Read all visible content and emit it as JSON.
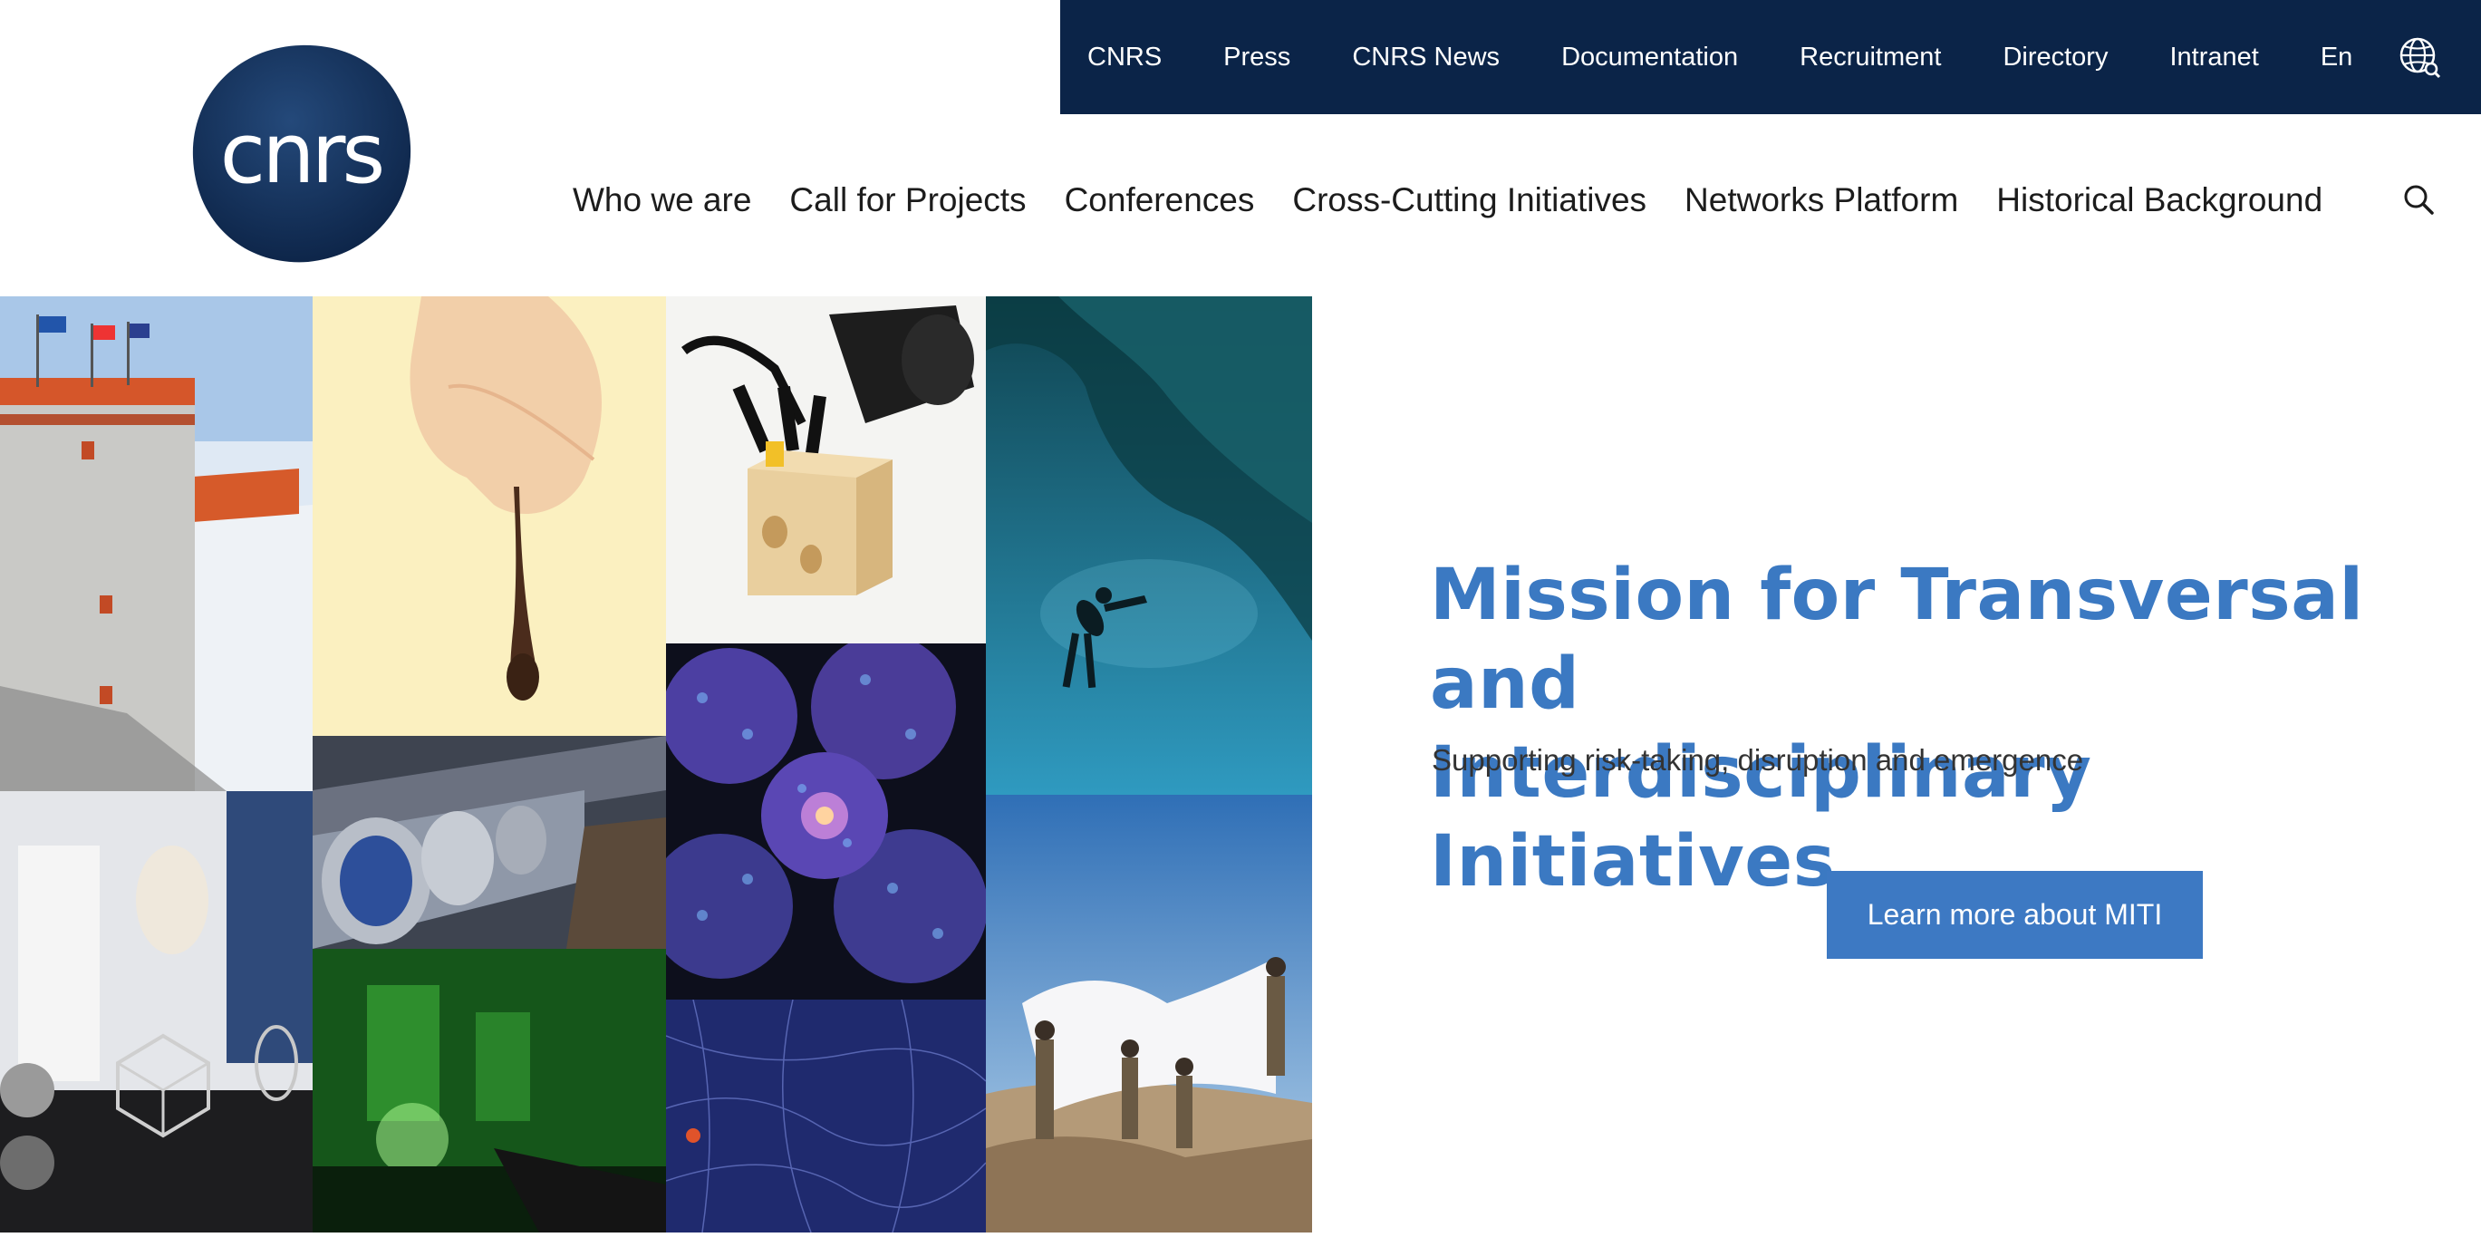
{
  "topbar": {
    "links": [
      "CNRS",
      "Press",
      "CNRS News",
      "Documentation",
      "Recruitment",
      "Directory",
      "Intranet",
      "En"
    ],
    "globe_icon": "globe-icon",
    "background": "#0b2448"
  },
  "logo": {
    "text": "cnrs",
    "icon": "cnrs-logo"
  },
  "nav": {
    "items": [
      "Who we are",
      "Call for Projects",
      "Conferences",
      "Cross-Cutting Initiatives",
      "Networks Platform",
      "Historical Background"
    ],
    "search_icon": "search-icon"
  },
  "mosaic": {
    "tiles": [
      "antarctic-station-photo",
      "honey-drop-photo",
      "robot-hand-photo",
      "ice-diver-photo",
      "lab-3d-lattice-photo",
      "particle-accelerator-photo",
      "cell-microscopy-photo",
      "green-laser-lab-photo",
      "neural-network-photo",
      "archaeology-team-photo"
    ]
  },
  "hero": {
    "title_line1": "Mission for Transversal and",
    "title_line2": "Interdisciplinary Initiatives",
    "subtitle": "Supporting risk-taking, disruption and emergence",
    "cta_label": "Learn more about MITI"
  },
  "colors": {
    "accent": "#3b79c2",
    "navy": "#0b2448"
  }
}
